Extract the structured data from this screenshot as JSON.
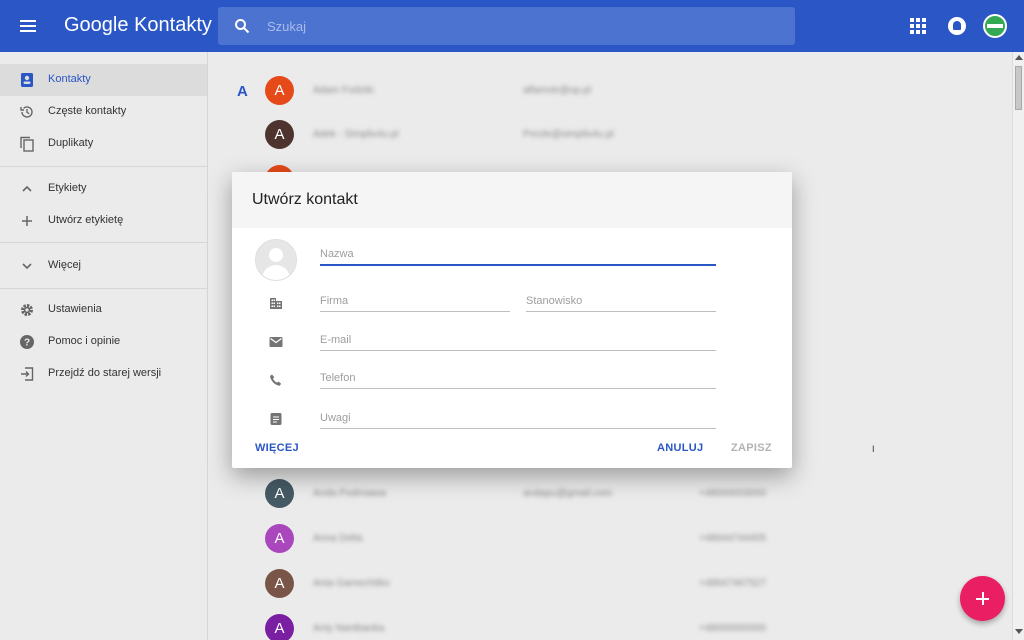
{
  "app": {
    "title_google": "Google",
    "title_product": "Kontakty"
  },
  "search": {
    "placeholder": "Szukaj"
  },
  "header_icons": [
    "menu-icon",
    "search-icon",
    "apps-grid-icon",
    "notifications-icon",
    "account-avatar"
  ],
  "colors": {
    "brand": "#2a56c6",
    "fab": "#e91e63",
    "background": "#ebebeb"
  },
  "sidebar": {
    "items": [
      {
        "label": "Kontakty",
        "icon": "contacts-icon",
        "active": true
      },
      {
        "label": "Częste kontakty",
        "icon": "history-icon"
      },
      {
        "label": "Duplikaty",
        "icon": "copy-icon"
      },
      {
        "label": "Etykiety",
        "icon": "chevron-up-icon"
      },
      {
        "label": "Utwórz etykietę",
        "icon": "plus-icon"
      },
      {
        "label": "Więcej",
        "icon": "chevron-down-icon"
      },
      {
        "label": "Ustawienia",
        "icon": "gear-icon"
      },
      {
        "label": "Pomoc i opinie",
        "icon": "help-icon"
      },
      {
        "label": "Przejdź do starej wersji",
        "icon": "exit-icon"
      }
    ]
  },
  "list": {
    "section_letter": "A",
    "rows": [
      {
        "initial": "A",
        "color": "#e64a19",
        "name": "Adam Fodziki",
        "email": "alfamotr@op.pl",
        "phone": ""
      },
      {
        "initial": "A",
        "color": "#4e342e",
        "name": "Adek - Simplix4u.pl",
        "email": "Porzle@simplix4u.pl",
        "phone": ""
      },
      {
        "initial": "A",
        "color": "#455a64",
        "name": "Anda Podmiawa",
        "email": "andapu@gmail.com",
        "phone": "+48000003000"
      },
      {
        "initial": "A",
        "color": "#ab47bc",
        "name": "Anna Delta",
        "email": "",
        "phone": "+48644744405"
      },
      {
        "initial": "A",
        "color": "#795548",
        "name": "Anta Gamechtiko",
        "email": "",
        "phone": "+48647467527"
      },
      {
        "initial": "A",
        "color": "#7b1fa2",
        "name": "Anty Nantbanka",
        "email": "",
        "phone": "+48000000000"
      }
    ]
  },
  "dialog": {
    "title": "Utwórz kontakt",
    "fields": {
      "name_placeholder": "Nazwa",
      "company_placeholder": "Firma",
      "job_placeholder": "Stanowisko",
      "email_placeholder": "E-mail",
      "phone_placeholder": "Telefon",
      "notes_placeholder": "Uwagi"
    },
    "buttons": {
      "more": "WIĘCEJ",
      "cancel": "ANULUJ",
      "save": "ZAPISZ"
    }
  },
  "fab": {
    "icon": "plus-icon"
  }
}
